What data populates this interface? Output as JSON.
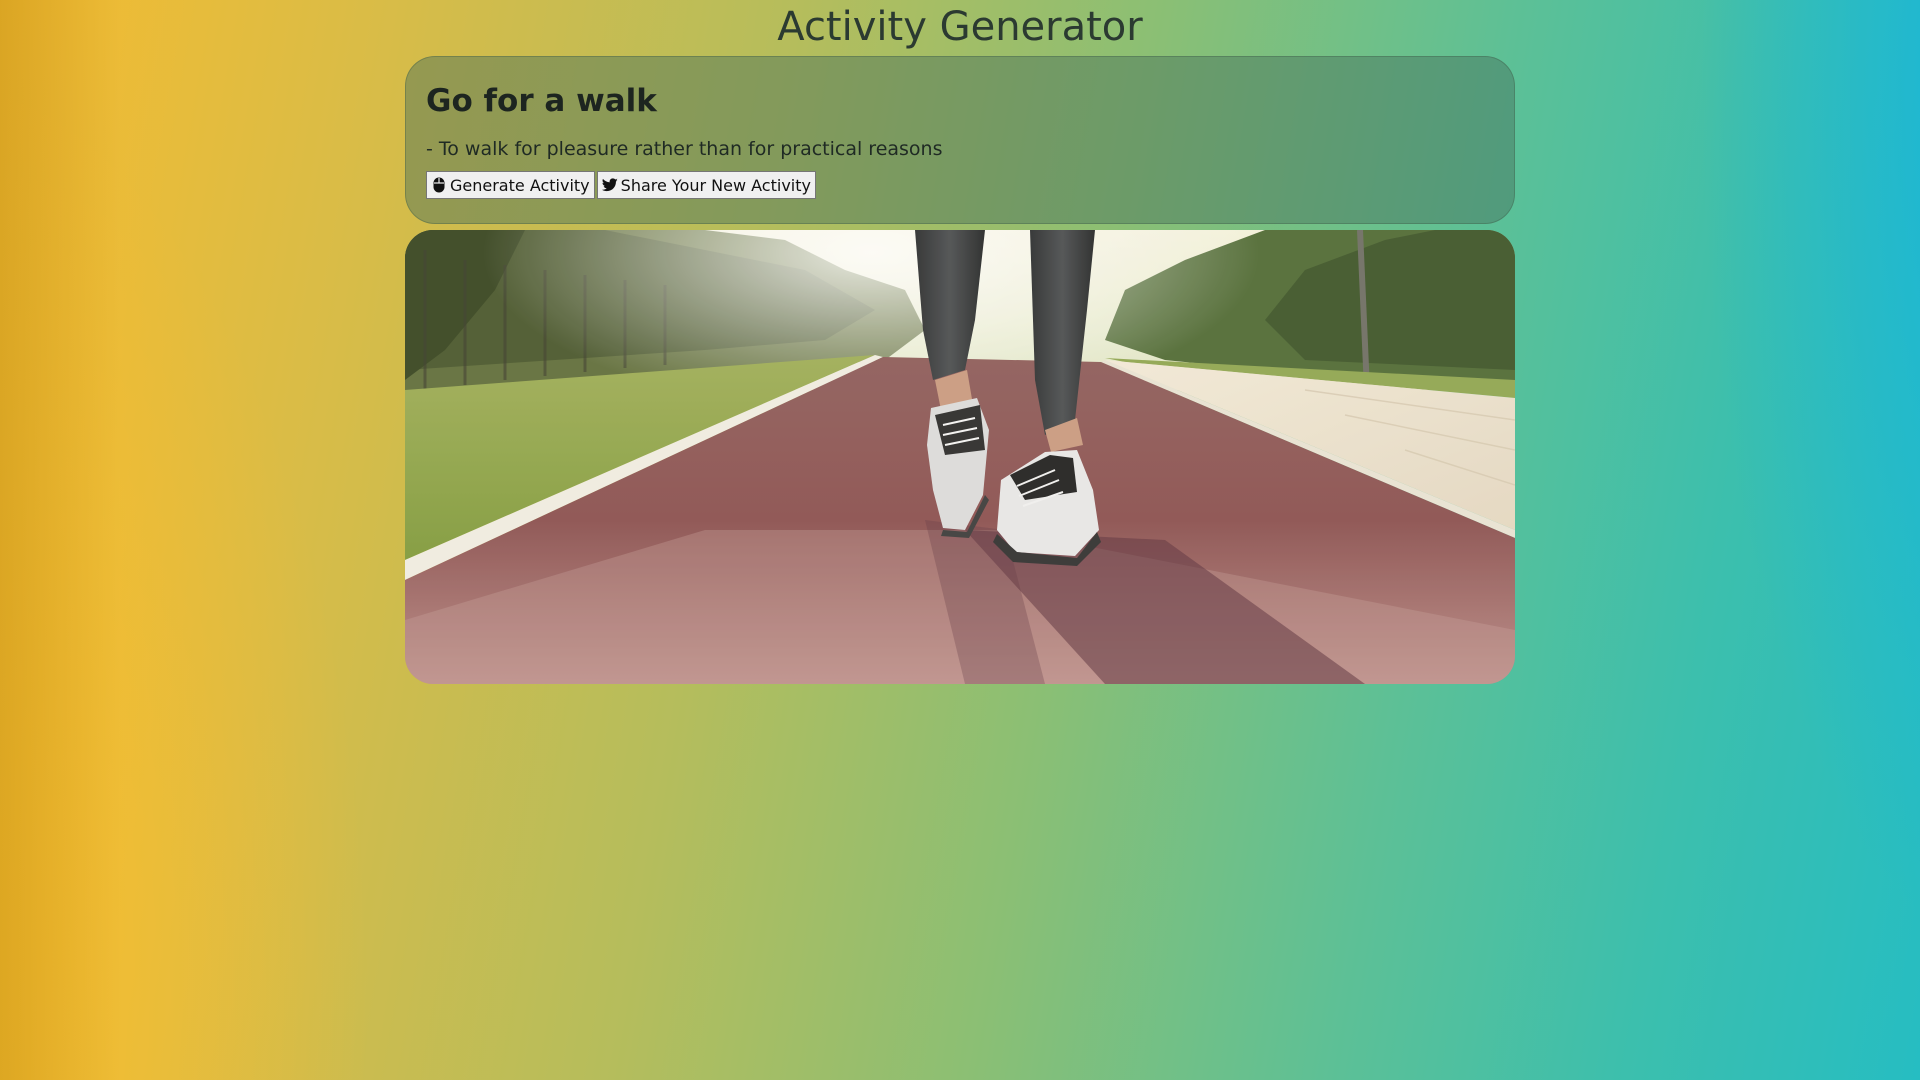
{
  "app": {
    "title": "Activity Generator"
  },
  "activity": {
    "name": "Go for a walk",
    "description": "- To walk for pleasure rather than for practical reasons"
  },
  "buttons": {
    "generate_label": "Generate Activity",
    "generate_icon": "mouse-icon",
    "share_label": "Share Your New Activity",
    "share_icon": "twitter-bird-icon"
  },
  "image": {
    "subject": "walking-shoes-on-running-track-photo"
  },
  "colors": {
    "gradient_left": "#f5bb2f",
    "gradient_right": "#26bdc2",
    "card_tint": "#466e5a"
  }
}
